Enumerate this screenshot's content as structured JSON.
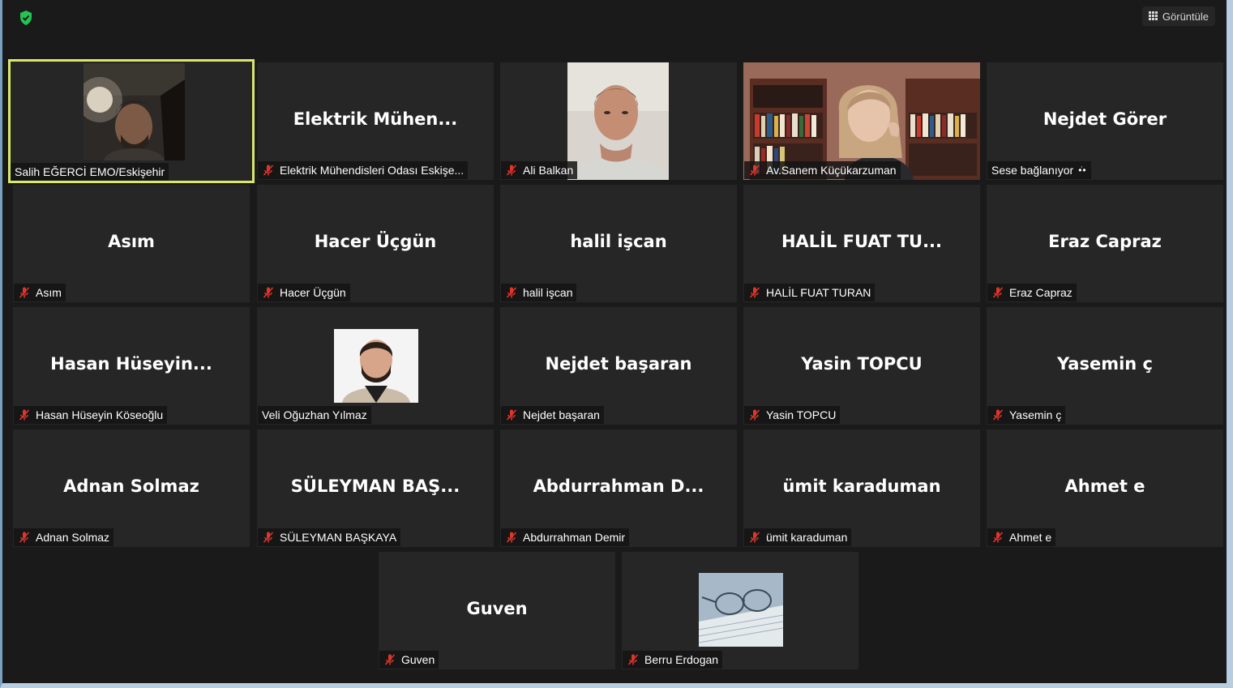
{
  "topbar": {
    "security_icon": "shield-check-icon",
    "security_color": "#23c552",
    "view_label": "Görüntüle",
    "view_icon": "grid-icon"
  },
  "active_speaker_color": "#d9e86a",
  "muted_icon_color": "#e0352b",
  "participants": [
    {
      "display": "",
      "label": "Salih EĞERCİ EMO/Eskişehir",
      "muted": false,
      "video": "video-feed-man-car"
    },
    {
      "display": "Elektrik  Mühen...",
      "label": "Elektrik Mühendisleri Odası Eskişe...",
      "muted": true
    },
    {
      "display": "",
      "label": "Ali Balkan",
      "muted": true,
      "video": "video-feed-man-white-shirt"
    },
    {
      "display": "",
      "label": "Av.Sanem Küçükarzuman",
      "muted": true,
      "video": "video-feed-woman-bookshelf"
    },
    {
      "display": "Nejdet Görer",
      "label": "Sese bağlanıyor",
      "muted": false,
      "connecting": true
    },
    {
      "display": "Asım",
      "label": "Asım",
      "muted": true
    },
    {
      "display": "Hacer Üçgün",
      "label": "Hacer Üçgün",
      "muted": true
    },
    {
      "display": "halil işcan",
      "label": "halil işcan",
      "muted": true
    },
    {
      "display": "HALİL FUAT TU...",
      "label": "HALİL FUAT TURAN",
      "muted": true
    },
    {
      "display": "Eraz Capraz",
      "label": "Eraz Capraz",
      "muted": true
    },
    {
      "display": "Hasan  Hüseyin...",
      "label": "Hasan Hüseyin Köseoğlu",
      "muted": true
    },
    {
      "display": "",
      "label": "Veli Oğuzhan Yılmaz",
      "muted": false,
      "video": "profile-photo-man-suit"
    },
    {
      "display": "Nejdet başaran",
      "label": "Nejdet başaran",
      "muted": true
    },
    {
      "display": "Yasin TOPCU",
      "label": "Yasin TOPCU",
      "muted": true
    },
    {
      "display": "Yasemin ç",
      "label": "Yasemin ç",
      "muted": true
    },
    {
      "display": "Adnan Solmaz",
      "label": "Adnan Solmaz",
      "muted": true
    },
    {
      "display": "SÜLEYMAN  BAŞ...",
      "label": "SÜLEYMAN BAŞKAYA",
      "muted": true
    },
    {
      "display": "Abdurrahman  D...",
      "label": "Abdurrahman Demir",
      "muted": true
    },
    {
      "display": "ümit karaduman",
      "label": "ümit karaduman",
      "muted": true
    },
    {
      "display": "Ahmet e",
      "label": "Ahmet e",
      "muted": true
    },
    {
      "display": "Guven",
      "label": "Guven",
      "muted": true
    },
    {
      "display": "",
      "label": "Berru Erdogan",
      "muted": true,
      "video": "profile-photo-glasses-book"
    }
  ]
}
